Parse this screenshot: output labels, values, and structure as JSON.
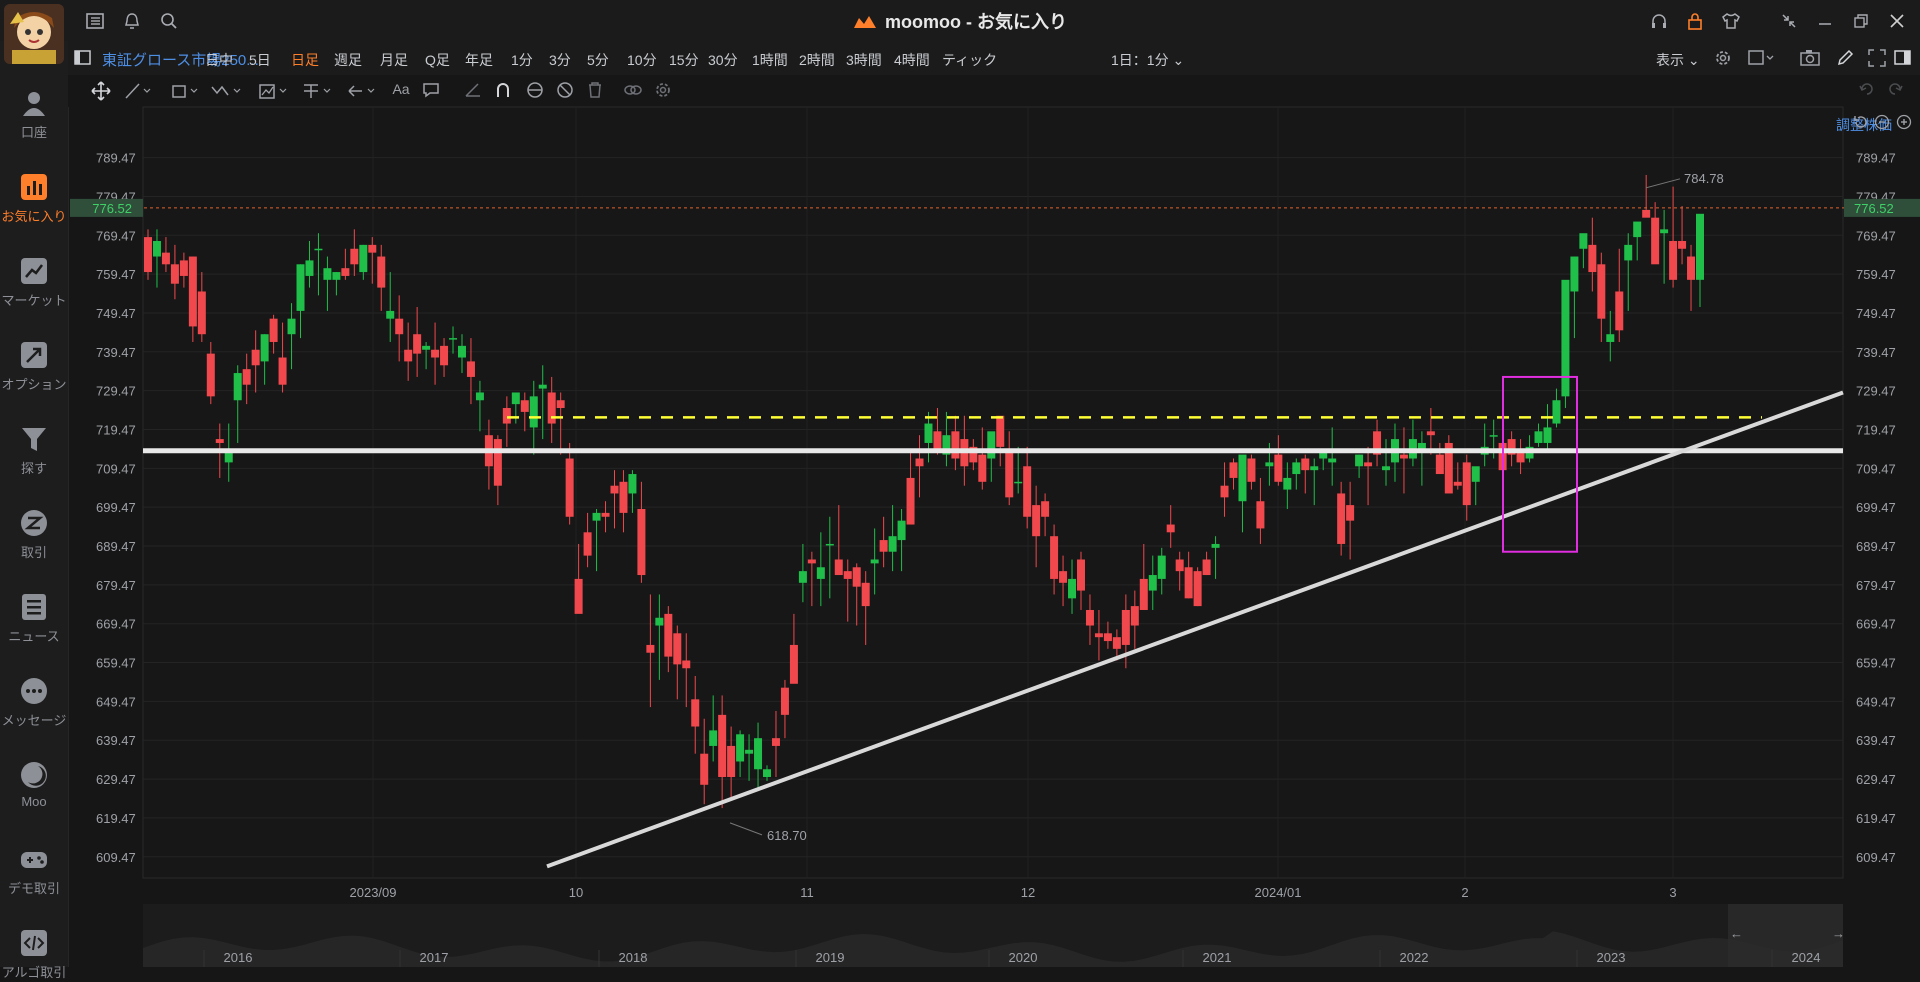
{
  "window": {
    "title": "moomoo - お気に入り"
  },
  "toolbar": {
    "symbol": "東証グロース市場250...",
    "periods": [
      "日中",
      "5日",
      "日足",
      "週足",
      "月足",
      "Q足",
      "年足",
      "1分",
      "3分",
      "5分",
      "10分",
      "15分",
      "30分",
      "1時間",
      "2時間",
      "3時間",
      "4時間",
      "ティック"
    ],
    "active_period": "日足",
    "interval_selector": "1日：1分",
    "display_label": "表示"
  },
  "nav": {
    "items": [
      {
        "label": "口座",
        "icon": "person-icon"
      },
      {
        "label": "お気に入り",
        "icon": "bar-chart-icon",
        "active": true
      },
      {
        "label": "マーケット",
        "icon": "trend-icon"
      },
      {
        "label": "オプション",
        "icon": "option-icon"
      },
      {
        "label": "探す",
        "icon": "funnel-icon"
      },
      {
        "label": "取引",
        "icon": "trade-icon"
      },
      {
        "label": "ニュース",
        "icon": "news-icon"
      },
      {
        "label": "メッセージ",
        "icon": "message-icon"
      },
      {
        "label": "Moo",
        "icon": "moon-icon"
      },
      {
        "label": "デモ取引",
        "icon": "gamepad-icon"
      },
      {
        "label": "アルゴ取引",
        "icon": "code-icon"
      }
    ]
  },
  "chart_labels": {
    "adjust": "調整株価",
    "current_price": "776.52",
    "high_label": "784.78",
    "low_label": "618.70"
  },
  "chart_data": {
    "type": "candlestick",
    "y_ticks": [
      "789.47",
      "779.47",
      "769.47",
      "759.47",
      "749.47",
      "739.47",
      "729.47",
      "719.47",
      "709.47",
      "699.47",
      "689.47",
      "679.47",
      "669.47",
      "659.47",
      "649.47",
      "639.47",
      "629.47",
      "619.47",
      "609.47"
    ],
    "ylim": [
      604,
      794
    ],
    "x_ticks": [
      "2023/09",
      "10",
      "11",
      "12",
      "2024/01",
      "2",
      "3"
    ],
    "timeline_labels": [
      "2016",
      "2017",
      "2018",
      "2019",
      "2020",
      "2021",
      "2022",
      "2023",
      "2024"
    ],
    "high": 784.78,
    "low": 618.7,
    "last": 776.52,
    "horizontal_lines": [
      {
        "value": 714,
        "color": "#e8e8e8",
        "style": "solid"
      },
      {
        "value": 722.6,
        "color": "#ffff33",
        "style": "dashed"
      },
      {
        "value": 776.52,
        "color": "#e0632d",
        "style": "dotted"
      }
    ],
    "trendline": {
      "from": [
        0,
        607
      ],
      "to": [
        1,
        729
      ]
    },
    "highlight_box": {
      "y_top": 733,
      "y_bottom": 688,
      "color": "#e02ee0"
    },
    "candles": [
      [
        769,
        771,
        758,
        760
      ],
      [
        764,
        771,
        756,
        768
      ],
      [
        765,
        769,
        760,
        762
      ],
      [
        762,
        767,
        753,
        757
      ],
      [
        763,
        765,
        756,
        759
      ],
      [
        764,
        764,
        742,
        746
      ],
      [
        755,
        760,
        742,
        744
      ],
      [
        739,
        742,
        726,
        728
      ],
      [
        717,
        721,
        707,
        716
      ],
      [
        711,
        721,
        706,
        714
      ],
      [
        727,
        736,
        716,
        734
      ],
      [
        735,
        739,
        726,
        731
      ],
      [
        740,
        745,
        729,
        736
      ],
      [
        737,
        744,
        731,
        744
      ],
      [
        748,
        749,
        739,
        742
      ],
      [
        738,
        747,
        729,
        731
      ],
      [
        744,
        752,
        735,
        748
      ],
      [
        750,
        762,
        743,
        762
      ],
      [
        759,
        768,
        756,
        763
      ],
      [
        766,
        770,
        754,
        766
      ],
      [
        758,
        764,
        750,
        761
      ],
      [
        758,
        760,
        754,
        760
      ],
      [
        761,
        766,
        758,
        759
      ],
      [
        766,
        771,
        759,
        762
      ],
      [
        760,
        767,
        758,
        767
      ],
      [
        767,
        769,
        757,
        765
      ],
      [
        764,
        767,
        750,
        756
      ],
      [
        748,
        760,
        742,
        750
      ],
      [
        748,
        754,
        737,
        744
      ],
      [
        740,
        747,
        732,
        737
      ],
      [
        744,
        751,
        733,
        739
      ],
      [
        740,
        742,
        735,
        741
      ],
      [
        740,
        747,
        731,
        738
      ],
      [
        741,
        743,
        733,
        736
      ],
      [
        743,
        746,
        739,
        743
      ],
      [
        738,
        744,
        734,
        741
      ],
      [
        737,
        743,
        726,
        733
      ],
      [
        727,
        732,
        719,
        729
      ],
      [
        718,
        722,
        704,
        710
      ],
      [
        717,
        718,
        700,
        705
      ],
      [
        725,
        728,
        715,
        721
      ],
      [
        726,
        728,
        721,
        729
      ],
      [
        727,
        729,
        719,
        724
      ],
      [
        720,
        732,
        713,
        728
      ],
      [
        730,
        736,
        717,
        731
      ],
      [
        729,
        733,
        716,
        721
      ],
      [
        727,
        729,
        713,
        725
      ],
      [
        712,
        716,
        695,
        697
      ],
      [
        681,
        690,
        675,
        672
      ],
      [
        693,
        698,
        684,
        687
      ],
      [
        696,
        699,
        683,
        698
      ],
      [
        698,
        701,
        693,
        697
      ],
      [
        705,
        709,
        694,
        703
      ],
      [
        706,
        709,
        693,
        698
      ],
      [
        703,
        709,
        698,
        708
      ],
      [
        699,
        706,
        680,
        682
      ],
      [
        664,
        677,
        648,
        662
      ],
      [
        669,
        677,
        655,
        671
      ],
      [
        672,
        674,
        657,
        661
      ],
      [
        667,
        669,
        650,
        659
      ],
      [
        660,
        667,
        648,
        658
      ],
      [
        650,
        656,
        636,
        643
      ],
      [
        636,
        645,
        623,
        628
      ],
      [
        638,
        651,
        634,
        642
      ],
      [
        646,
        651,
        622,
        630
      ],
      [
        638,
        643,
        624,
        630
      ],
      [
        634,
        642,
        630,
        641
      ],
      [
        636,
        641,
        629,
        637
      ],
      [
        632,
        644,
        627,
        640
      ],
      [
        630,
        633,
        629,
        632
      ],
      [
        640,
        647,
        630,
        638
      ],
      [
        653,
        655,
        640,
        646
      ],
      [
        664,
        672,
        658,
        654
      ],
      [
        680,
        690,
        675,
        683
      ],
      [
        686,
        688,
        674,
        685
      ],
      [
        681,
        693,
        674,
        684
      ],
      [
        690,
        697,
        676,
        690
      ],
      [
        686,
        700,
        682,
        682
      ],
      [
        683,
        686,
        670,
        681
      ],
      [
        684,
        685,
        669,
        679
      ],
      [
        680,
        683,
        664,
        674
      ],
      [
        685,
        694,
        677,
        686
      ],
      [
        691,
        697,
        684,
        688
      ],
      [
        688,
        700,
        683,
        692
      ],
      [
        691,
        699,
        683,
        696
      ],
      [
        707,
        714,
        702,
        695
      ],
      [
        712,
        718,
        702,
        710
      ],
      [
        716,
        724,
        711,
        721
      ],
      [
        719,
        725,
        713,
        714
      ],
      [
        713,
        724,
        710,
        718
      ],
      [
        719,
        723,
        709,
        712
      ],
      [
        717,
        723,
        705,
        710
      ],
      [
        715,
        717,
        709,
        711
      ],
      [
        713,
        720,
        704,
        706
      ],
      [
        712,
        718,
        706,
        719
      ],
      [
        723,
        722,
        710,
        715
      ],
      [
        714,
        719,
        700,
        702
      ],
      [
        706,
        715,
        703,
        706
      ],
      [
        710,
        715,
        694,
        697
      ],
      [
        700,
        705,
        684,
        692
      ],
      [
        701,
        703,
        692,
        697
      ],
      [
        692,
        695,
        677,
        681
      ],
      [
        683,
        687,
        674,
        680
      ],
      [
        676,
        686,
        672,
        681
      ],
      [
        686,
        688,
        673,
        678
      ],
      [
        673,
        677,
        664,
        669
      ],
      [
        667,
        673,
        660,
        666
      ],
      [
        667,
        670,
        663,
        665
      ],
      [
        666,
        668,
        660,
        663
      ],
      [
        673,
        677,
        658,
        664
      ],
      [
        674,
        678,
        663,
        669
      ],
      [
        681,
        690,
        675,
        673
      ],
      [
        678,
        687,
        673,
        682
      ],
      [
        681,
        689,
        677,
        687
      ],
      [
        695,
        700,
        689,
        693
      ],
      [
        686,
        688,
        678,
        683
      ],
      [
        684,
        688,
        676,
        676
      ],
      [
        683,
        684,
        674,
        674
      ],
      [
        686,
        688,
        682,
        682
      ],
      [
        689,
        692,
        681,
        690
      ],
      [
        705,
        711,
        697,
        702
      ],
      [
        711,
        712,
        704,
        707
      ],
      [
        701,
        712,
        693,
        713
      ],
      [
        712,
        713,
        704,
        706
      ],
      [
        701,
        707,
        690,
        694
      ],
      [
        710,
        716,
        705,
        711
      ],
      [
        713,
        718,
        705,
        706
      ],
      [
        704,
        711,
        699,
        707
      ],
      [
        708,
        712,
        704,
        711
      ],
      [
        712,
        713,
        703,
        709
      ],
      [
        709,
        712,
        700,
        710
      ],
      [
        712,
        714,
        709,
        714
      ],
      [
        711,
        720,
        705,
        712
      ],
      [
        703,
        706,
        687,
        690
      ],
      [
        700,
        706,
        686,
        696
      ],
      [
        710,
        713,
        707,
        713
      ],
      [
        711,
        715,
        700,
        710
      ],
      [
        719,
        722,
        710,
        713
      ],
      [
        709,
        717,
        705,
        710
      ],
      [
        711,
        721,
        706,
        717
      ],
      [
        713,
        720,
        703,
        712
      ],
      [
        712,
        722,
        710,
        717
      ],
      [
        714,
        719,
        705,
        716
      ],
      [
        719,
        725,
        713,
        718
      ],
      [
        713,
        716,
        709,
        708
      ],
      [
        716,
        718,
        704,
        703
      ],
      [
        706,
        711,
        704,
        705
      ],
      [
        711,
        713,
        696,
        700
      ],
      [
        706,
        709,
        700,
        710
      ],
      [
        713,
        721,
        710,
        715
      ],
      [
        718,
        722,
        712,
        718
      ],
      [
        716,
        722,
        708,
        709
      ],
      [
        717,
        719,
        710,
        713
      ],
      [
        714,
        717,
        708,
        711
      ],
      [
        712,
        718,
        711,
        715
      ],
      [
        716,
        721,
        715,
        719
      ],
      [
        716,
        726,
        714,
        720
      ],
      [
        721,
        730,
        720,
        727
      ],
      [
        728,
        733,
        725,
        758
      ],
      [
        755,
        764,
        743,
        764
      ],
      [
        766,
        768,
        761,
        770
      ],
      [
        767,
        774,
        755,
        760
      ],
      [
        762,
        765,
        742,
        748
      ],
      [
        742,
        750,
        737,
        744
      ],
      [
        755,
        766,
        742,
        745
      ],
      [
        763,
        770,
        750,
        767
      ],
      [
        769,
        772,
        763,
        773
      ],
      [
        776,
        785,
        776,
        774
      ],
      [
        774,
        778,
        770,
        762
      ],
      [
        770,
        776,
        757,
        771
      ],
      [
        768,
        782,
        756,
        758
      ],
      [
        768,
        777,
        762,
        766
      ],
      [
        764,
        767,
        750,
        758
      ],
      [
        758,
        763,
        751,
        775
      ]
    ]
  }
}
